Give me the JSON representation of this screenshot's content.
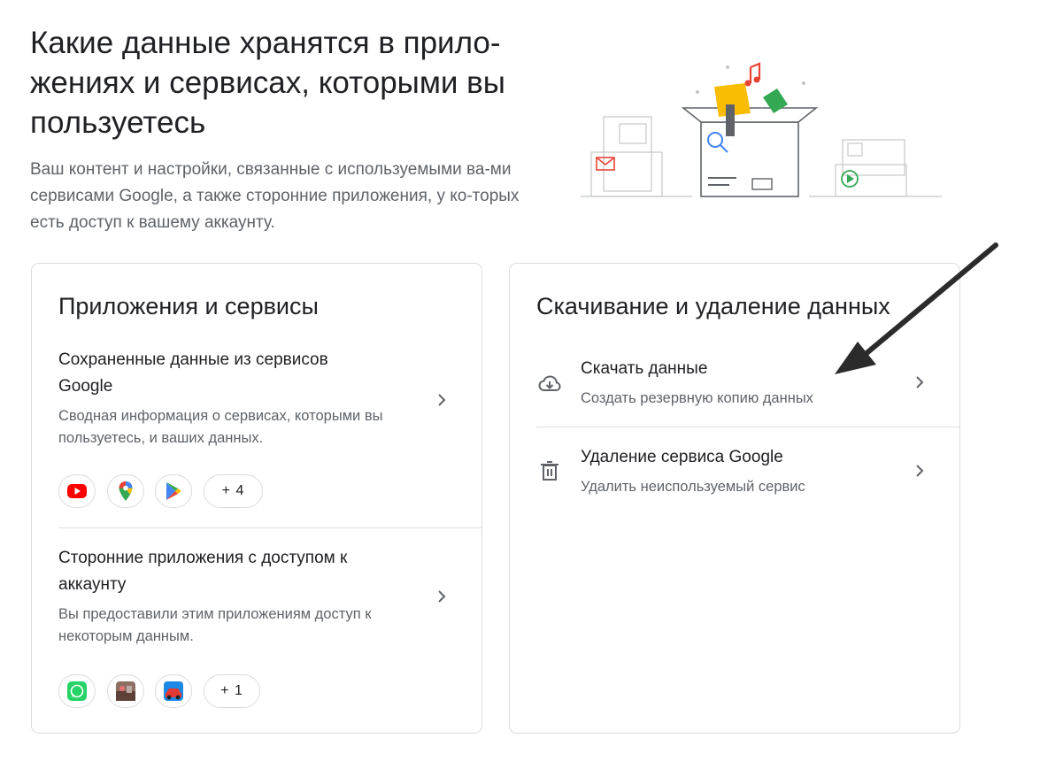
{
  "header": {
    "title": "Какие данные хранятся в прило-жениях и сервисах, которыми вы пользуетесь",
    "subtitle": "Ваш контент и настройки, связанные с используемыми ва-ми сервисами Google, а также сторонние приложения, у ко-торых есть доступ к вашему аккаунту."
  },
  "apps_card": {
    "title": "Приложения и сервисы",
    "saved_data": {
      "title": "Сохраненные данные из сервисов Google",
      "description": "Сводная информация о сервисах, которыми вы пользуетесь, и ваших данных.",
      "chips": [
        {
          "icon": "youtube-icon"
        },
        {
          "icon": "google-maps-icon"
        },
        {
          "icon": "google-play-icon"
        }
      ],
      "more_label": "+ 4"
    },
    "third_party": {
      "title": "Сторонние приложения с доступом к аккаунту",
      "description": "Вы предоставили этим приложениям доступ к некоторым данным.",
      "chips": [
        {
          "icon": "whatsapp-icon"
        },
        {
          "icon": "game-app-icon"
        },
        {
          "icon": "racing-app-icon"
        }
      ],
      "more_label": "+ 1"
    }
  },
  "data_card": {
    "title": "Скачивание и удаление данных",
    "download": {
      "title": "Скачать данные",
      "description": "Создать резервную копию данных",
      "icon": "cloud-download-icon"
    },
    "delete_service": {
      "title": "Удаление сервиса Google",
      "description": "Удалить неиспользуемый сервис",
      "icon": "trash-icon"
    }
  },
  "colors": {
    "youtube": "#ff0000",
    "maps_red": "#ea4335",
    "play_blue": "#4285f4",
    "whatsapp": "#25d366",
    "hero_yellow": "#fbbc04",
    "hero_green": "#34a853",
    "annotation_arrow": "#2b2b2b"
  }
}
